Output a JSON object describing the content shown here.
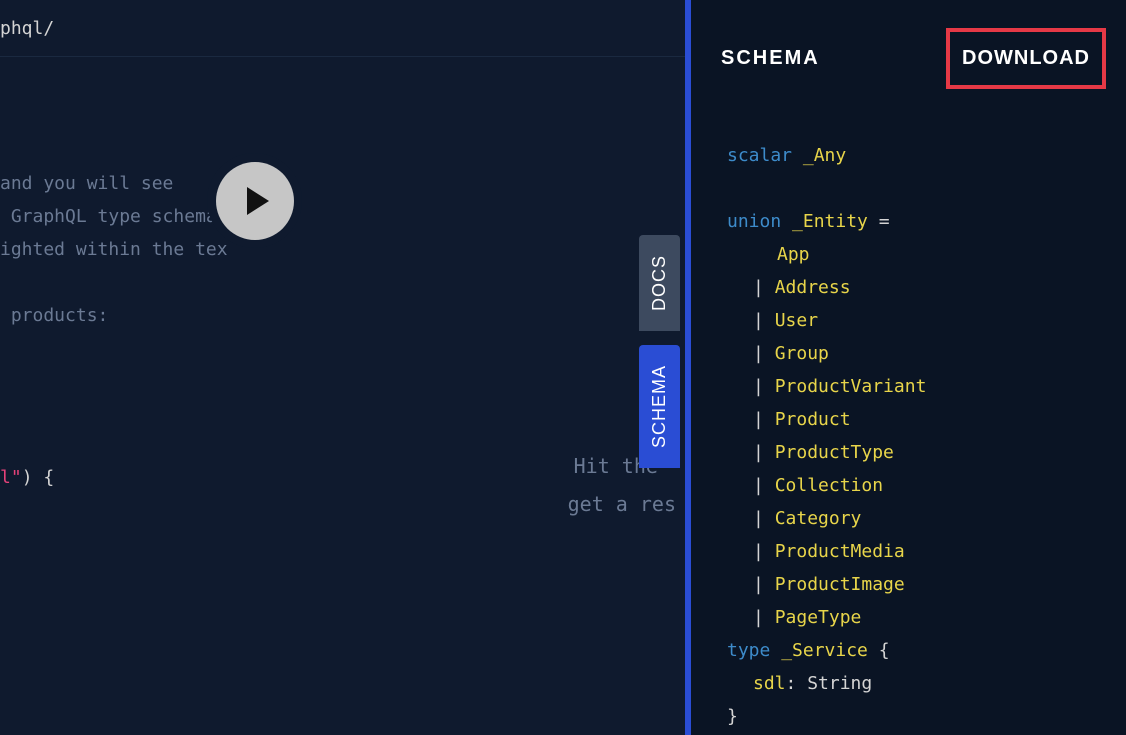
{
  "url_fragment": "phql/",
  "editor": {
    "comment_lines": [
      "and you will see",
      " GraphQL type schema",
      "ighted within the tex",
      "",
      " products:"
    ],
    "code_string": "l\"",
    "code_after": ") {"
  },
  "play_button_label": "Execute Query",
  "response_hint_line1": "Hit the",
  "response_hint_line2": "get a res",
  "side_tabs": {
    "docs": "DOCS",
    "schema": "SCHEMA"
  },
  "schema_panel": {
    "title": "SCHEMA",
    "download_label": "DOWNLOAD",
    "scalar_keyword": "scalar",
    "scalar_name": "_Any",
    "union_keyword": "union",
    "union_name": "_Entity",
    "equals": "=",
    "union_types": [
      "App",
      "Address",
      "User",
      "Group",
      "ProductVariant",
      "Product",
      "ProductType",
      "Collection",
      "Category",
      "ProductMedia",
      "ProductImage",
      "PageType"
    ],
    "type_keyword": "type",
    "type_name": "_Service",
    "field_name": "sdl",
    "field_type": "String"
  }
}
